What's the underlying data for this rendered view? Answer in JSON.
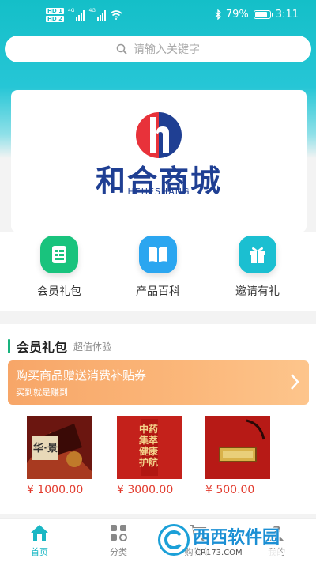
{
  "status_bar": {
    "hd_top": "HD 1",
    "hd_bottom": "HD 2",
    "signal_label_1": "4G",
    "signal_label_2": "4G",
    "battery_percent": "79%",
    "time": "3:11"
  },
  "search": {
    "placeholder": "请输入关键字"
  },
  "banner": {
    "brand_name": "和合商城",
    "brand_sub": "HEHESHANG",
    "brand_colors": {
      "primary": "#1f3f93",
      "accent": "#e8323a"
    }
  },
  "quick_nav": [
    {
      "label": "会员礼包",
      "icon": "document-icon",
      "color": "#19c37d"
    },
    {
      "label": "产品百科",
      "icon": "book-icon",
      "color": "#2ba6f0"
    },
    {
      "label": "邀请有礼",
      "icon": "gift-icon",
      "color": "#1bbfd1"
    }
  ],
  "section": {
    "title": "会员礼包",
    "subtitle": "超值体验",
    "promo_title": "购买商品赠送消费补贴券",
    "promo_sub": "买到就是赚到",
    "products": [
      {
        "price": "¥ 1000.00",
        "image_text": "华·景"
      },
      {
        "price": "¥ 3000.00",
        "image_text": "中药集萃 健康护航"
      },
      {
        "price": "¥ 500.00",
        "image_text": ""
      }
    ]
  },
  "tabbar": {
    "tabs": [
      {
        "label": "首页",
        "icon": "home-icon",
        "active": true
      },
      {
        "label": "分类",
        "icon": "category-icon",
        "active": false
      },
      {
        "label": "购物车",
        "icon": "cart-icon",
        "active": false
      },
      {
        "label": "我的",
        "icon": "user-icon",
        "active": false
      }
    ]
  },
  "watermark": {
    "brand": "西西软件园",
    "url": "CR173.COM"
  },
  "colors": {
    "header": "#14bfc8",
    "accent_green": "#19b37e",
    "price_red": "#e23b2e",
    "tab_active": "#1ab7c4"
  }
}
